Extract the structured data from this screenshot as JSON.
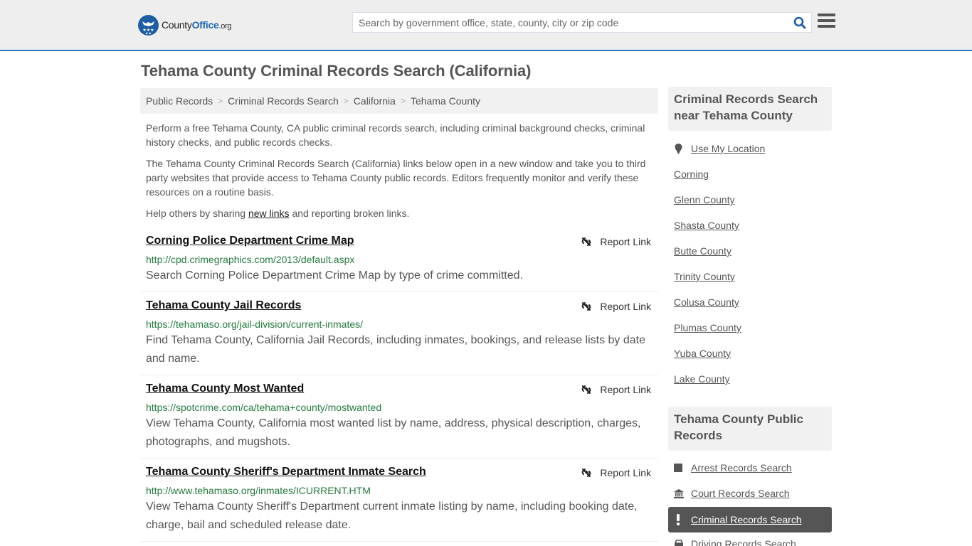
{
  "header": {
    "logo": {
      "part1": "County",
      "part2": "Office",
      "part3": ".org"
    },
    "search": {
      "placeholder": "Search by government office, state, county, city or zip code",
      "value": ""
    },
    "icons": {
      "search": "search-icon",
      "menu": "hamburger-menu-icon"
    },
    "accent_color": "#337ab7"
  },
  "main": {
    "title": "Tehama County Criminal Records Search (California)",
    "breadcrumb": [
      "Public Records",
      "Criminal Records Search",
      "California",
      "Tehama County"
    ],
    "breadcrumb_separator": ">",
    "intro": {
      "p1": "Perform a free Tehama County, CA public criminal records search, including criminal background checks, criminal history checks, and public records checks.",
      "p2": "The Tehama County Criminal Records Search (California) links below open in a new window and take you to third party websites that provide access to Tehama County public records. Editors frequently monitor and verify these resources on a routine basis.",
      "p3_before": "Help others by sharing ",
      "p3_link": "new links",
      "p3_after": " and reporting broken links."
    },
    "report_label": "Report Link",
    "results": [
      {
        "title": "Corning Police Department Crime Map",
        "url": "http://cpd.crimegraphics.com/2013/default.aspx",
        "description": "Search Corning Police Department Crime Map by type of crime committed."
      },
      {
        "title": "Tehama County Jail Records",
        "url": "https://tehamaso.org/jail-division/current-inmates/",
        "description": "Find Tehama County, California Jail Records, including inmates, bookings, and release lists by date and name."
      },
      {
        "title": "Tehama County Most Wanted",
        "url": "https://spotcrime.com/ca/tehama+county/mostwanted",
        "description": "View Tehama County, California most wanted list by name, address, physical description, charges, photographs, and mugshots."
      },
      {
        "title": "Tehama County Sheriff's Department Inmate Search",
        "url": "http://www.tehamaso.org/inmates/ICURRENT.HTM",
        "description": "View Tehama County Sheriff's Department current inmate listing by name, including booking date, charge, bail and scheduled release date."
      }
    ]
  },
  "sidebar": {
    "nearby": {
      "heading": "Criminal Records Search near Tehama County",
      "use_location": "Use My Location",
      "links": [
        "Corning",
        "Glenn County",
        "Shasta County",
        "Butte County",
        "Trinity County",
        "Colusa County",
        "Plumas County",
        "Yuba County",
        "Lake County"
      ]
    },
    "public_records": {
      "heading": "Tehama County Public Records",
      "items": [
        {
          "label": "Arrest Records Search",
          "icon": "square-icon"
        },
        {
          "label": "Court Records Search",
          "icon": "courthouse-icon"
        },
        {
          "label": "Criminal Records Search",
          "icon": "exclamation-icon",
          "active": true
        },
        {
          "label": "Driving Records Search",
          "icon": "car-icon"
        }
      ]
    }
  }
}
